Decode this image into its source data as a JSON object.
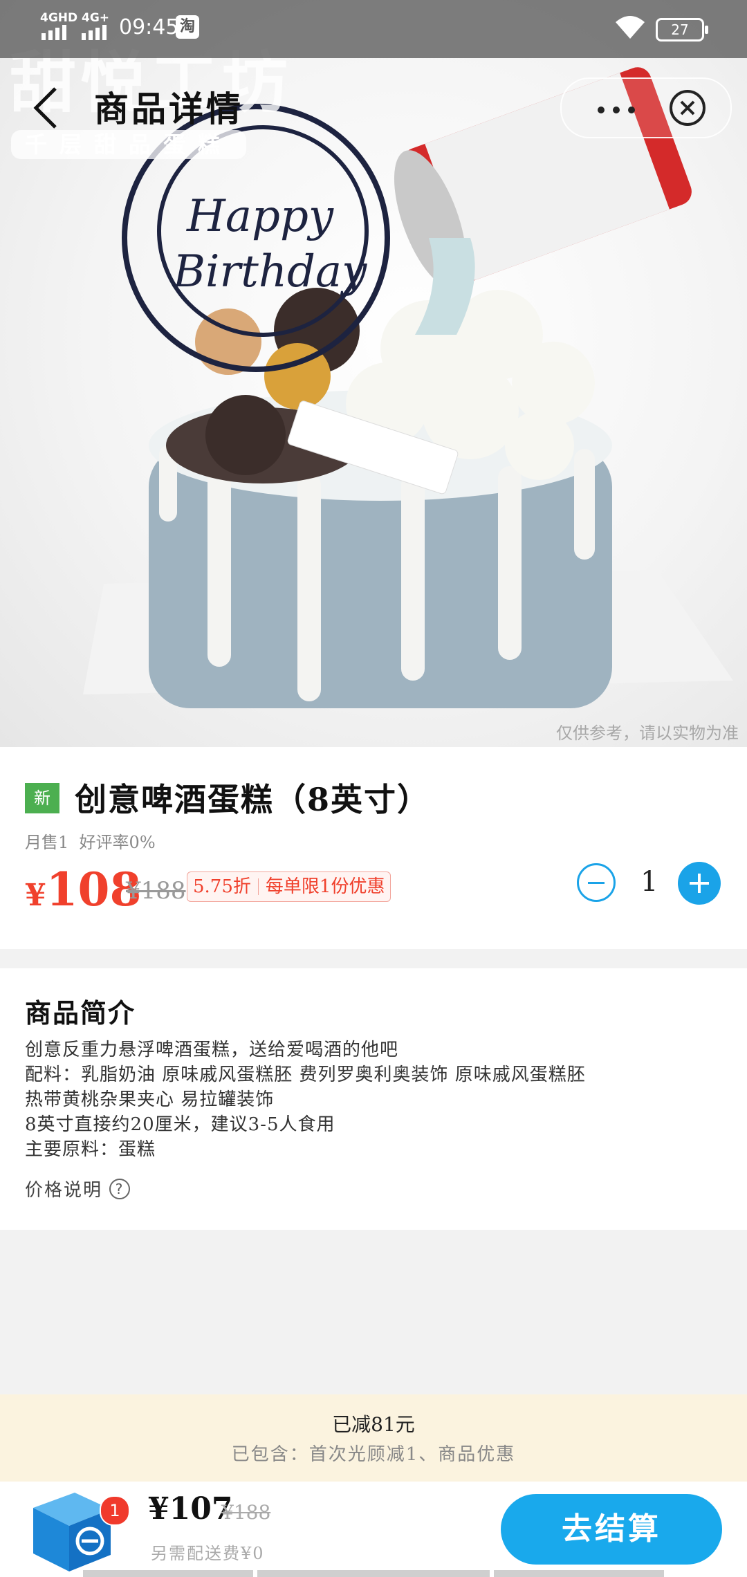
{
  "status_bar": {
    "network_1": "4GHD",
    "network_2": "4G+",
    "time": "09:45",
    "app_icon": "淘",
    "battery": "27"
  },
  "nav": {
    "title": "商品详情",
    "back_icon": "chevron-left-icon",
    "more_icon": "more-dots-icon",
    "close_icon": "close-circle-icon"
  },
  "hero": {
    "watermark_logo": "甜悦工坊",
    "watermark_sub": "千层甜品蛋糕",
    "disclaimer": "仅供参考，请以实物为准"
  },
  "product": {
    "badge": "新",
    "title": "创意啤酒蛋糕（8英寸）",
    "monthly_sales": "月售1",
    "rating": "好评率0%",
    "currency": "¥",
    "price": "108",
    "original_price": "¥188",
    "discount": "5.75折",
    "limit": "每单限1份优惠",
    "quantity": "1"
  },
  "description": {
    "heading": "商品简介",
    "lines": [
      "创意反重力悬浮啤酒蛋糕，送给爱喝酒的他吧",
      "配料：乳脂奶油 原味戚风蛋糕胚 费列罗奥利奥装饰 原味戚风蛋糕胚",
      "热带黄桃杂果夹心 易拉罐装饰",
      "8英寸直接约20厘米，建议3-5人食用",
      "主要原料：蛋糕"
    ],
    "price_explain": "价格说明",
    "help_icon": "?"
  },
  "discount_bar": {
    "main": "已减81元",
    "sub": "已包含：首次光顾减1、商品优惠"
  },
  "cart": {
    "badge": "1",
    "total": "¥107",
    "original": "¥188",
    "delivery": "另需配送费¥0",
    "checkout": "去结算"
  },
  "colors": {
    "accent_blue": "#19a9ec",
    "price_red": "#f0402c",
    "new_badge_green": "#4caf50",
    "discount_bg": "#fbf3df"
  }
}
